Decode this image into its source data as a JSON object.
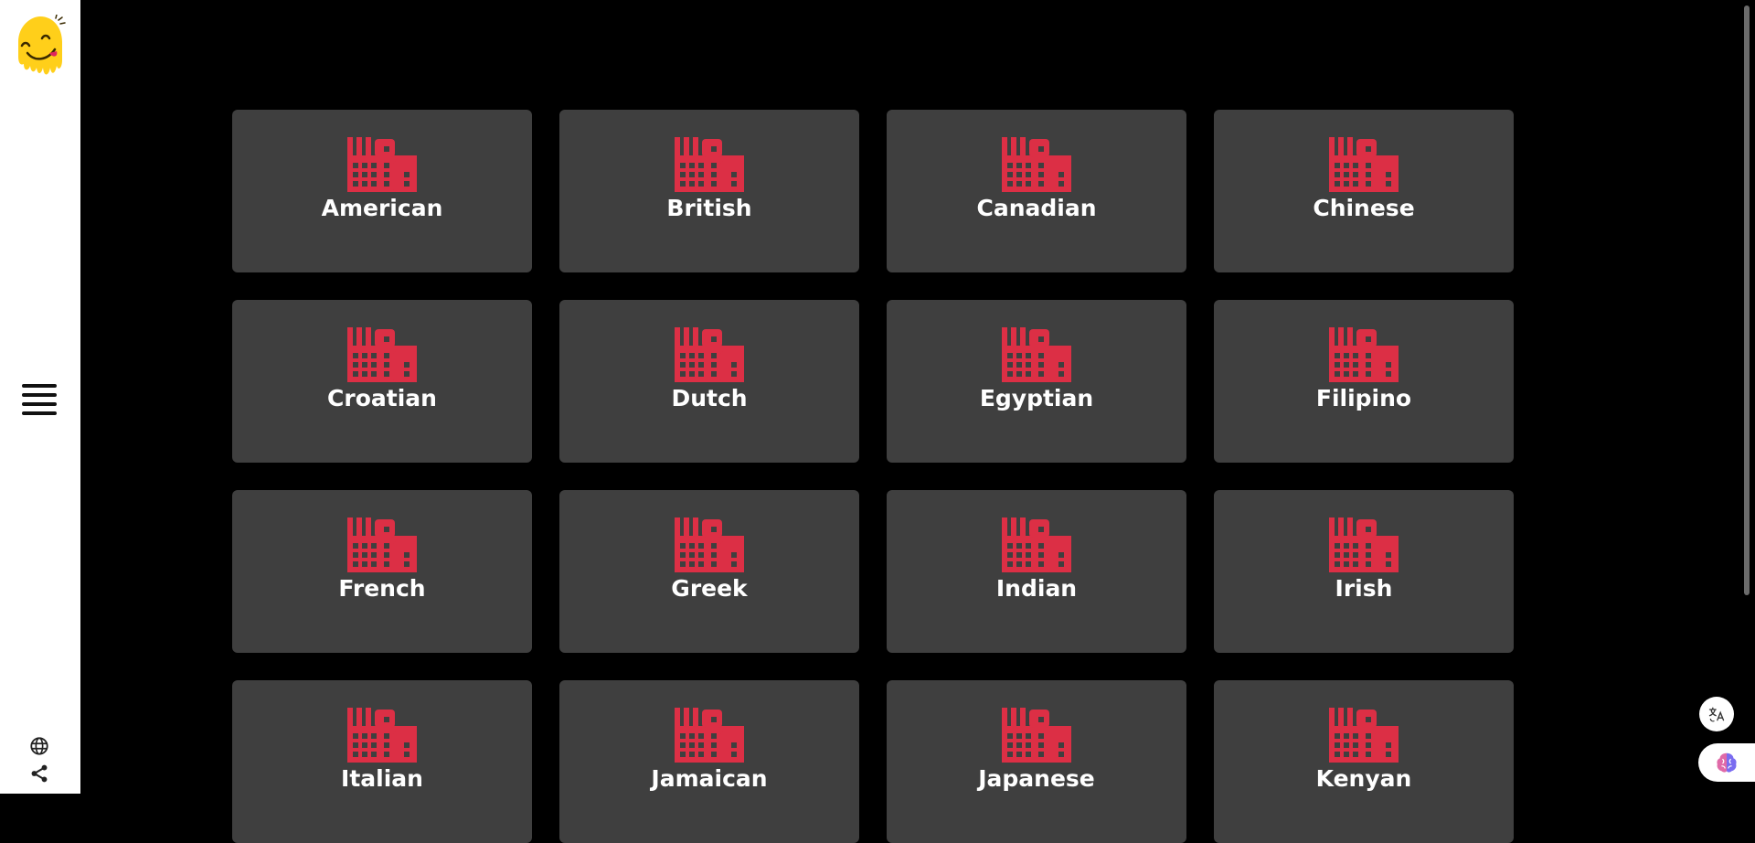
{
  "sidebar": {
    "logo_icon": "melting-smiley-logo",
    "menu_icon": "hamburger-menu-icon",
    "bottom_icons": [
      "globe-icon",
      "share-icon"
    ]
  },
  "card_icon": "factory-icon",
  "colors": {
    "background": "#000000",
    "sidebar": "#ffffff",
    "card": "#3f3f3f",
    "icon_red": "#dc2f45",
    "label": "#ffffff"
  },
  "cuisines": [
    {
      "label": "American"
    },
    {
      "label": "British"
    },
    {
      "label": "Canadian"
    },
    {
      "label": "Chinese"
    },
    {
      "label": "Croatian"
    },
    {
      "label": "Dutch"
    },
    {
      "label": "Egyptian"
    },
    {
      "label": "Filipino"
    },
    {
      "label": "French"
    },
    {
      "label": "Greek"
    },
    {
      "label": "Indian"
    },
    {
      "label": "Irish"
    },
    {
      "label": "Italian"
    },
    {
      "label": "Jamaican"
    },
    {
      "label": "Japanese"
    },
    {
      "label": "Kenyan"
    }
  ],
  "floating": {
    "translate_icon": "translate-icon",
    "assistant_icon": "brain-icon"
  }
}
